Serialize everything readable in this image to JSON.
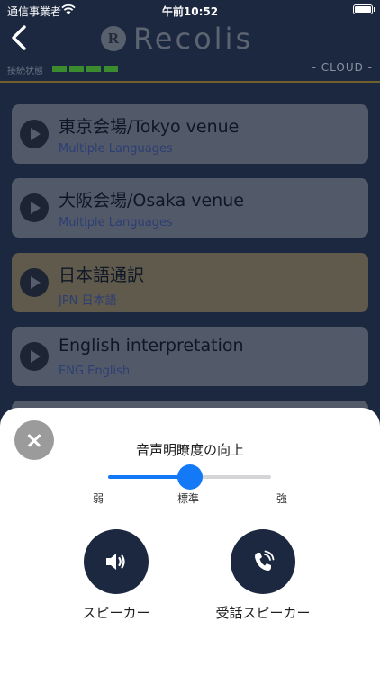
{
  "status_bar": {
    "carrier": "通信事業者",
    "time": "午前10:52"
  },
  "header": {
    "logo_mark": "R",
    "logo_text": "Recolis",
    "connection_label": "接続状態",
    "connection_bars": 4,
    "cloud_label": "- CLOUD -"
  },
  "channels": [
    {
      "title": "東京会場/Tokyo venue",
      "subtitle": "Multiple Languages",
      "color": "#525a69"
    },
    {
      "title": "大阪会場/Osaka venue",
      "subtitle": "Multiple Languages",
      "color": "#525a69"
    },
    {
      "title": "日本語通訳",
      "subtitle": "JPN 日本語",
      "color": "#5f5a4b"
    },
    {
      "title": "English interpretation",
      "subtitle": "ENG English",
      "color": "#525a69"
    }
  ],
  "sheet": {
    "title": "音声明瞭度の向上",
    "slider": {
      "min_label": "弱",
      "mid_label": "標準",
      "max_label": "強",
      "value": 0.5
    },
    "speaker_button_label": "スピーカー",
    "receiver_button_label": "受話スピーカー"
  },
  "colors": {
    "accent": "#1479f6",
    "dark_button": "#1c2840",
    "connection_green": "#3b8c2e",
    "gold_divider": "#6e5f2c"
  },
  "icons": {
    "back": "chevron-left-icon",
    "close": "close-icon",
    "speaker": "speaker-volume-icon",
    "receiver": "phone-receiver-icon",
    "play": "play-icon",
    "wifi": "wifi-icon",
    "battery": "battery-icon"
  }
}
